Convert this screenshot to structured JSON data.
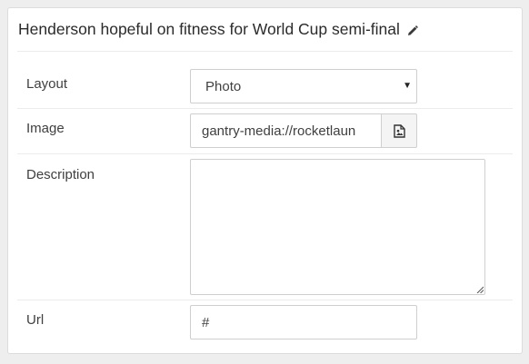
{
  "card": {
    "title": "Henderson hopeful on fitness for World Cup semi-final",
    "edit_icon": "pencil-icon"
  },
  "fields": {
    "layout": {
      "label": "Layout",
      "value": "Photo",
      "caret_icon": "caret-down-icon"
    },
    "image": {
      "label": "Image",
      "value": "gantry-media://rocketlaun",
      "picker_icon": "image-file-icon"
    },
    "description": {
      "label": "Description",
      "value": ""
    },
    "url": {
      "label": "Url",
      "value": "#"
    }
  }
}
